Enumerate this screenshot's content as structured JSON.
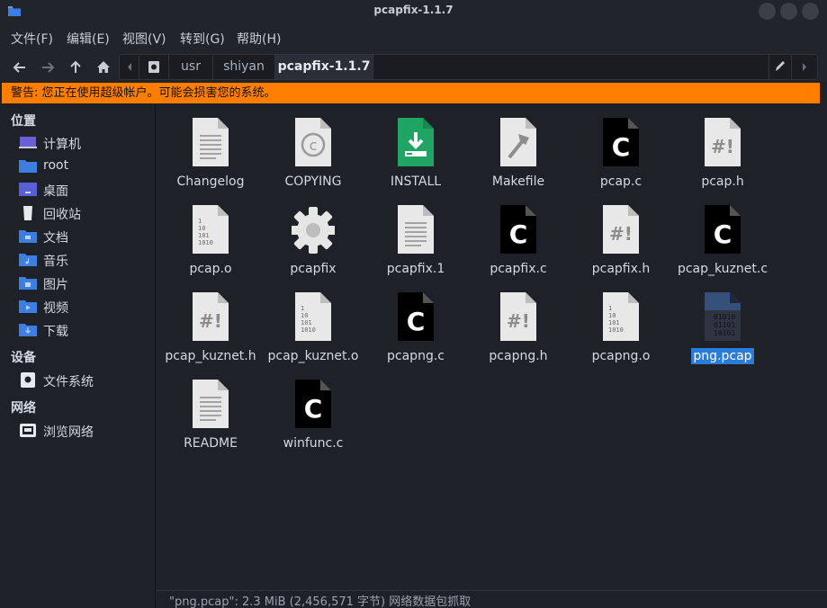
{
  "window": {
    "title": "pcapfix-1.1.7"
  },
  "menu": [
    "文件(F)",
    "编辑(E)",
    "视图(V)",
    "转到(G)",
    "帮助(H)"
  ],
  "path": [
    "usr",
    "shiyan",
    "pcapfix-1.1.7"
  ],
  "warning": "警告: 您正在使用超级帐户。可能会损害您的系统。",
  "sidebar": {
    "places_header": "位置",
    "places": [
      {
        "label": "计算机",
        "icon": "computer-icon"
      },
      {
        "label": "root",
        "icon": "home-folder-icon"
      },
      {
        "label": "桌面",
        "icon": "desktop-icon"
      },
      {
        "label": "回收站",
        "icon": "trash-icon"
      },
      {
        "label": "文档",
        "icon": "documents-folder-icon"
      },
      {
        "label": "音乐",
        "icon": "music-folder-icon"
      },
      {
        "label": "图片",
        "icon": "pictures-folder-icon"
      },
      {
        "label": "视频",
        "icon": "videos-folder-icon"
      },
      {
        "label": "下载",
        "icon": "downloads-folder-icon"
      }
    ],
    "devices_header": "设备",
    "devices": [
      {
        "label": "文件系统",
        "icon": "drive-icon"
      }
    ],
    "network_header": "网络",
    "network": [
      {
        "label": "浏览网络",
        "icon": "network-icon"
      }
    ]
  },
  "files": [
    {
      "name": "Changelog",
      "type": "text"
    },
    {
      "name": "COPYING",
      "type": "copyright"
    },
    {
      "name": "INSTALL",
      "type": "install"
    },
    {
      "name": "Makefile",
      "type": "makefile"
    },
    {
      "name": "pcap.c",
      "type": "c-source"
    },
    {
      "name": "pcap.h",
      "type": "header"
    },
    {
      "name": "pcap.o",
      "type": "binary"
    },
    {
      "name": "pcapfix",
      "type": "executable"
    },
    {
      "name": "pcapfix.1",
      "type": "text"
    },
    {
      "name": "pcapfix.c",
      "type": "c-source"
    },
    {
      "name": "pcapfix.h",
      "type": "header"
    },
    {
      "name": "pcap_kuznet.c",
      "type": "c-source"
    },
    {
      "name": "pcap_kuznet.h",
      "type": "header"
    },
    {
      "name": "pcap_kuznet.o",
      "type": "binary"
    },
    {
      "name": "pcapng.c",
      "type": "c-source"
    },
    {
      "name": "pcapng.h",
      "type": "header"
    },
    {
      "name": "pcapng.o",
      "type": "binary"
    },
    {
      "name": "png.pcap",
      "type": "pcap",
      "selected": true
    },
    {
      "name": "README",
      "type": "text"
    },
    {
      "name": "winfunc.c",
      "type": "c-source"
    }
  ],
  "status": "\"png.pcap\": 2.3 MiB (2,456,571 字节) 网络数据包抓取",
  "colors": {
    "accent": "#2b7cd8",
    "warning_bg": "#ff7e00",
    "folder_blue": "#3d7ee0"
  }
}
